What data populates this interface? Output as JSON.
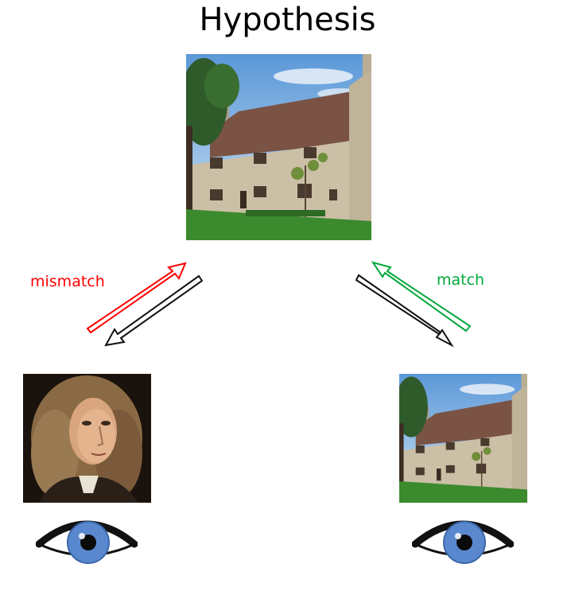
{
  "title": "Hypothesis",
  "labels": {
    "left": "mismatch",
    "right": "match"
  },
  "colors": {
    "mismatch": "#ff0000",
    "match": "#00a83a",
    "neutral_arrow": "#111111",
    "iris": "#5a88cf"
  },
  "images": {
    "hypothesis": "house-photo",
    "left_observation": "portrait-of-man",
    "right_observation": "house-photo"
  },
  "icons": [
    "eye-icon",
    "arrow-icon"
  ]
}
